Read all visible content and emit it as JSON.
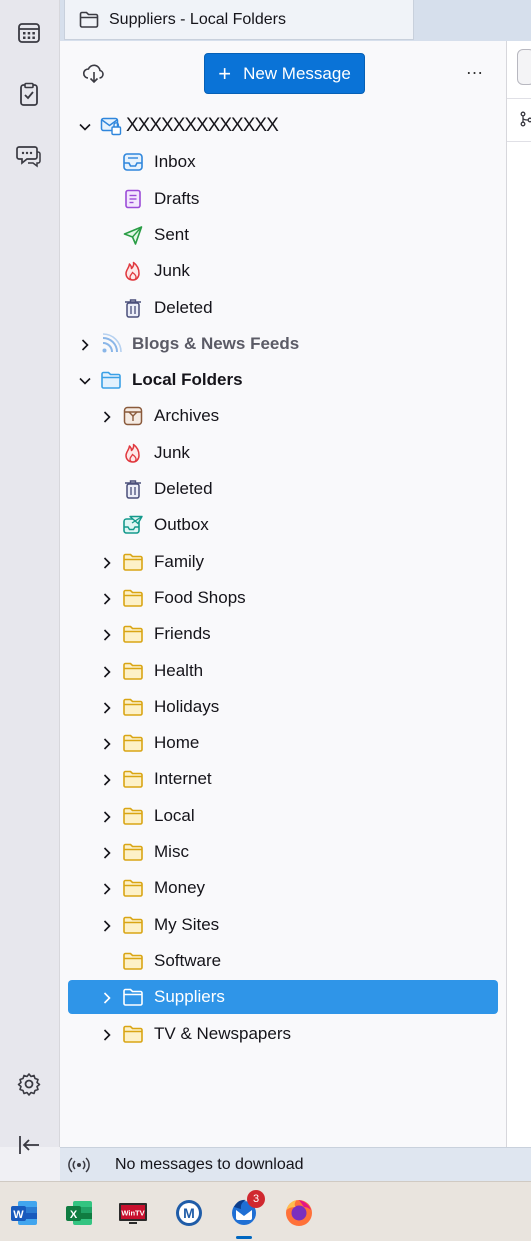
{
  "tab": {
    "title": "Suppliers - Local Folders"
  },
  "header": {
    "new_message_label": "New Message"
  },
  "tree": [
    {
      "label": "XXXXXXXXXXXXX",
      "icon": "mail-account-icon",
      "level": 0,
      "twisty": "open",
      "name": "account-xxxx"
    },
    {
      "label": "Inbox",
      "icon": "inbox-icon",
      "level": 1,
      "twisty": "none",
      "name": "folder-inbox"
    },
    {
      "label": "Drafts",
      "icon": "drafts-icon",
      "level": 1,
      "twisty": "none",
      "name": "folder-drafts"
    },
    {
      "label": "Sent",
      "icon": "sent-icon",
      "level": 1,
      "twisty": "none",
      "name": "folder-sent"
    },
    {
      "label": "Junk",
      "icon": "junk-icon",
      "level": 1,
      "twisty": "none",
      "name": "folder-junk"
    },
    {
      "label": "Deleted",
      "icon": "trash-icon",
      "level": 1,
      "twisty": "none",
      "name": "folder-deleted"
    },
    {
      "label": "Blogs & News Feeds",
      "icon": "rss-icon",
      "level": 0,
      "twisty": "closed",
      "name": "account-blogs-news-feeds"
    },
    {
      "label": "Local Folders",
      "icon": "local-folders-icon",
      "level": 0,
      "twisty": "open",
      "name": "account-local-folders"
    },
    {
      "label": "Archives",
      "icon": "archive-icon",
      "level": 1,
      "twisty": "closed",
      "name": "folder-archives"
    },
    {
      "label": "Junk",
      "icon": "junk-icon",
      "level": 1,
      "twisty": "none",
      "name": "folder-local-junk"
    },
    {
      "label": "Deleted",
      "icon": "trash-icon",
      "level": 1,
      "twisty": "none",
      "name": "folder-local-deleted"
    },
    {
      "label": "Outbox",
      "icon": "outbox-icon",
      "level": 1,
      "twisty": "none",
      "name": "folder-outbox"
    },
    {
      "label": "Family",
      "icon": "folder-icon",
      "level": 1,
      "twisty": "closed",
      "name": "folder-family"
    },
    {
      "label": "Food Shops",
      "icon": "folder-icon",
      "level": 1,
      "twisty": "closed",
      "name": "folder-food-shops"
    },
    {
      "label": "Friends",
      "icon": "folder-icon",
      "level": 1,
      "twisty": "closed",
      "name": "folder-friends"
    },
    {
      "label": "Health",
      "icon": "folder-icon",
      "level": 1,
      "twisty": "closed",
      "name": "folder-health"
    },
    {
      "label": "Holidays",
      "icon": "folder-icon",
      "level": 1,
      "twisty": "closed",
      "name": "folder-holidays"
    },
    {
      "label": "Home",
      "icon": "folder-icon",
      "level": 1,
      "twisty": "closed",
      "name": "folder-home"
    },
    {
      "label": "Internet",
      "icon": "folder-icon",
      "level": 1,
      "twisty": "closed",
      "name": "folder-internet"
    },
    {
      "label": "Local",
      "icon": "folder-icon",
      "level": 1,
      "twisty": "closed",
      "name": "folder-local"
    },
    {
      "label": "Misc",
      "icon": "folder-icon",
      "level": 1,
      "twisty": "closed",
      "name": "folder-misc"
    },
    {
      "label": "Money",
      "icon": "folder-icon",
      "level": 1,
      "twisty": "closed",
      "name": "folder-money"
    },
    {
      "label": "My Sites",
      "icon": "folder-icon",
      "level": 1,
      "twisty": "closed",
      "name": "folder-my-sites"
    },
    {
      "label": "Software",
      "icon": "folder-icon",
      "level": 1,
      "twisty": "none",
      "name": "folder-software"
    },
    {
      "label": "Suppliers",
      "icon": "folder-icon",
      "level": 1,
      "twisty": "closed",
      "selected": true,
      "name": "folder-suppliers"
    },
    {
      "label": "TV & Newspapers",
      "icon": "folder-icon",
      "level": 1,
      "twisty": "closed",
      "name": "folder-tv-newspapers"
    }
  ],
  "status": {
    "text": "No messages to download"
  },
  "taskbar": {
    "apps": [
      {
        "name": "word",
        "label": "W"
      },
      {
        "name": "excel",
        "label": "X"
      },
      {
        "name": "wintv",
        "label": "WinTV"
      },
      {
        "name": "malwarebytes",
        "label": "M"
      },
      {
        "name": "thunderbird",
        "label": "",
        "badge": "3",
        "active": true
      },
      {
        "name": "firefox",
        "label": ""
      }
    ]
  },
  "colors": {
    "accent": "#0a73d7",
    "selected_row": "#2f95e8",
    "folder_yellow": "#f6cf4f",
    "local_folders_blue": "#3aa0e6"
  }
}
